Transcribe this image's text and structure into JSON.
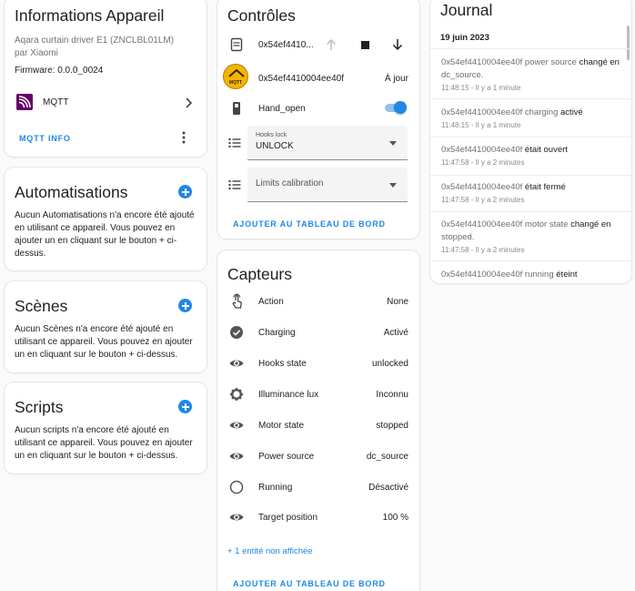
{
  "device_info": {
    "title": "Informations Appareil",
    "model": "Aqara curtain driver E1 (ZNCLBL01LM)",
    "manufacturer": "par Xiaomi",
    "firmware": "Firmware: 0.0.0_0024",
    "integration": "MQTT",
    "mqtt_info_label": "MQTT INFO"
  },
  "automations": {
    "title": "Automatisations",
    "empty_text": "Aucun Automatisations n'a encore été ajouté en utilisant ce appareil. Vous pouvez en ajouter un en cliquant sur le bouton + ci-dessus."
  },
  "scenes": {
    "title": "Scènes",
    "empty_text": "Aucun Scènes n'a encore été ajouté en utilisant ce appareil. Vous pouvez en ajouter un en cliquant sur le bouton + ci-dessus."
  },
  "scripts": {
    "title": "Scripts",
    "empty_text": "Aucun scripts n'a encore été ajouté en utilisant ce appareil. Vous pouvez en ajouter un en cliquant sur le bouton + ci-dessus."
  },
  "controls": {
    "title": "Contrôles",
    "cover_name": "0x54ef4410...",
    "update_name": "0x54ef4410004ee40f",
    "update_status": "À jour",
    "update_badge": "MQTT",
    "switch_name": "Hand_open",
    "hooks_lock_label": "Hooks lock",
    "hooks_lock_value": "UNLOCK",
    "limits_placeholder": "Limits calibration",
    "add_dashboard_label": "AJOUTER AU TABLEAU DE BORD"
  },
  "sensors": {
    "title": "Capteurs",
    "rows": [
      {
        "name": "Action",
        "value": "None"
      },
      {
        "name": "Charging",
        "value": "Activé"
      },
      {
        "name": "Hooks state",
        "value": "unlocked"
      },
      {
        "name": "Illuminance lux",
        "value": "Inconnu"
      },
      {
        "name": "Motor state",
        "value": "stopped"
      },
      {
        "name": "Power source",
        "value": "dc_source"
      },
      {
        "name": "Running",
        "value": "Désactivé"
      },
      {
        "name": "Target position",
        "value": "100 %"
      }
    ],
    "hidden_entities": "+ 1 entité non affichée",
    "add_dashboard_label": "AJOUTER AU TABLEAU DE BORD"
  },
  "journal": {
    "title": "Journal",
    "date": "19 juin 2023",
    "entries": [
      {
        "entity": "0x54ef4410004ee40f power source",
        "action": "changé en",
        "value": "dc_source.",
        "time": "11:48:15 - Il y a 1 minute"
      },
      {
        "entity": "0x54ef4410004ee40f charging",
        "action": "activé",
        "value": "",
        "time": "11:48:15 - Il y a 1 minute"
      },
      {
        "entity": "0x54ef4410004ee40f",
        "action": "était ouvert",
        "value": "",
        "time": "11:47:58 - Il y a 2 minutes"
      },
      {
        "entity": "0x54ef4410004ee40f",
        "action": "était fermé",
        "value": "",
        "time": "11:47:58 - Il y a 2 minutes"
      },
      {
        "entity": "0x54ef4410004ee40f motor state",
        "action": "changé en",
        "value": "stopped.",
        "time": "11:47:58 - Il y a 2 minutes"
      },
      {
        "entity": "0x54ef4410004ee40f running",
        "action": "éteint",
        "value": "",
        "time": ""
      }
    ]
  },
  "colors": {
    "accent": "#1e88e5",
    "mqtt_logo": "#660066",
    "badge_yellow": "#f5b400"
  }
}
